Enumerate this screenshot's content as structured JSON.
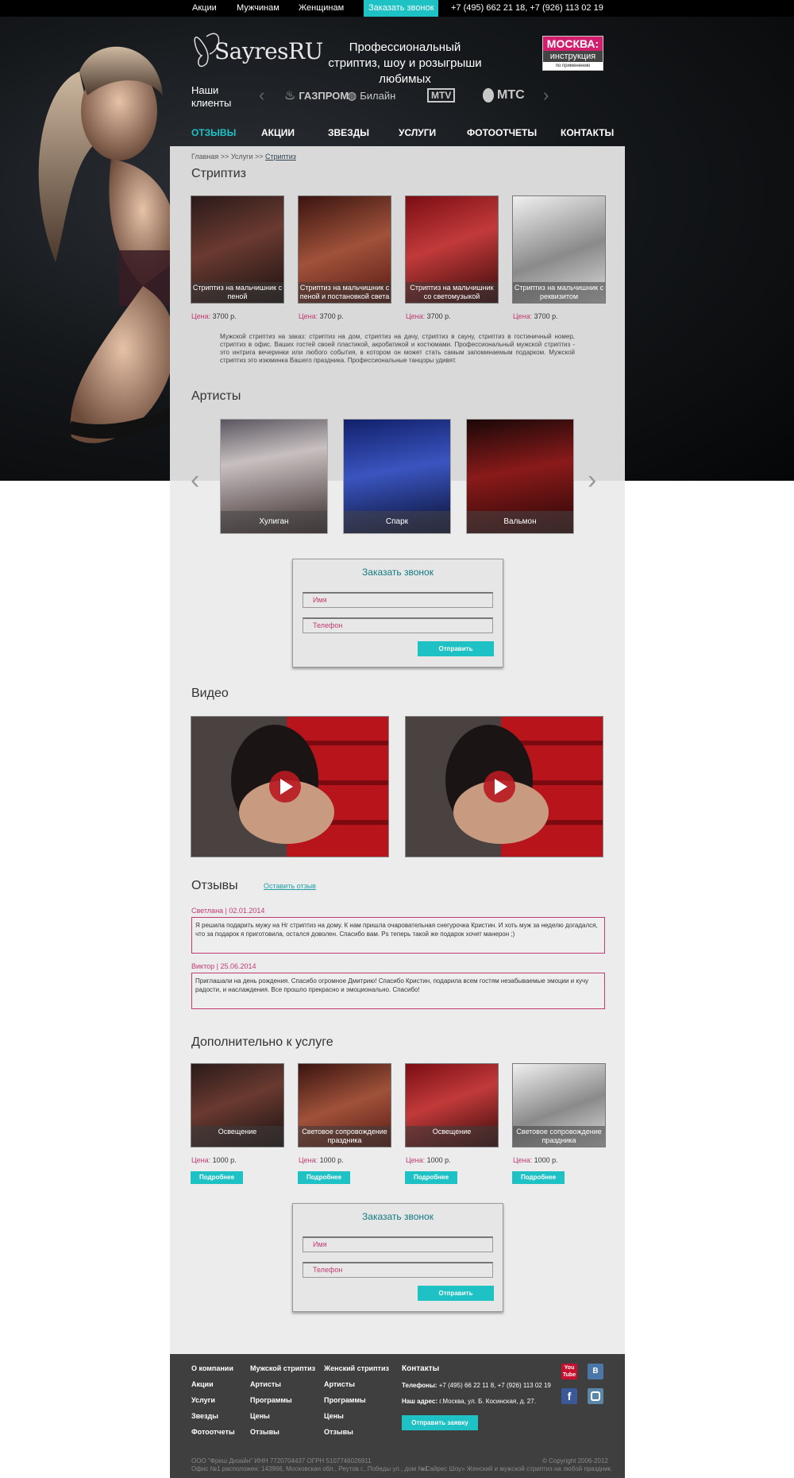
{
  "topbar": {
    "links": [
      "Акции",
      "Мужчинам",
      "Женщинам"
    ],
    "call_button": "Заказать звонок",
    "phones": "+7 (495) 662 21 18, +7 (926) 113 02 19"
  },
  "header": {
    "logo_text": "SayresRU",
    "tagline": "Профессиональный стриптиз, шоу и розыгрыши любимых",
    "moscow_badge": {
      "line1": "МОСКВА:",
      "line2": "инструкция",
      "line3": "по применению"
    },
    "clients_label": "Наши клиенты",
    "clients": [
      "ГАЗПРОМ",
      "Билайн",
      "MTV",
      "МТС"
    ]
  },
  "nav": [
    "ОТЗЫВЫ",
    "АКЦИИ",
    "ЗВЕЗДЫ",
    "УСЛУГИ",
    "ФОТООТЧЕТЫ",
    "КОНТАКТЫ"
  ],
  "breadcrumb": {
    "home": "Главная",
    "sep1": ">>",
    "services": "Услуги",
    "sep2": ">>",
    "current": "Стриптиз"
  },
  "striptease": {
    "title": "Стриптиз",
    "price_label": "Цена:",
    "items": [
      {
        "caption": "Стриптиз на мальчишник с пеной",
        "price": "3700 р."
      },
      {
        "caption": "Стриптиз на мальчишник с пеной и постановкой света",
        "price": "3700 р."
      },
      {
        "caption": "Стриптиз на мальчишник со светомузыкой",
        "price": "3700 р."
      },
      {
        "caption": "Стриптиз на мальчишник с реквизитом",
        "price": "3700 р."
      }
    ],
    "description": "Мужской стриптиз на заказ: стриптиз на дом, стриптиз на дачу, стриптиз в сауну, стриптиз в гостиничный номер, стриптиз в офис. Ваших гостей своей пластикой, акробатикой и костюмами. Профессиональный мужской стриптиз - это интрига вечеринки или любого события, в котором он может стать самым запоминаемым подарком. Мужской стриптиз это изюминка Вашего праздника. Профессиональные танцоры удивят."
  },
  "artists": {
    "title": "Артисты",
    "items": [
      "Хулиган",
      "Спарк",
      "Вальмон"
    ]
  },
  "callback_form": {
    "title": "Заказать звонок",
    "name_placeholder": "Имя",
    "phone_placeholder": "Телефон",
    "submit": "Отправить"
  },
  "video": {
    "title": "Видео"
  },
  "reviews": {
    "title": "Отзывы",
    "leave_link": "Оставить отзыв",
    "items": [
      {
        "author": "Светлана | 02.01.2014",
        "text": "Я решила подарить мужу на Нг стриптиз на дому. К нам пришла очаровательная снегурочка Кристин. И хоть муж за неделю догадался, что за подарок я приготовила, остался доволен. Спасибо вам. Ps теперь такой же подарок хочет манерон ;)"
      },
      {
        "author": "Виктор | 25.06.2014",
        "text": "Приглашали на день рождения. Спасибо огромное Дмитрию! Спасибо Кристин, подарила всем гостям незабываемые эмоции и кучу радости, и наслаждения. Все прошло прекрасно и эмоционально. Спасибо!"
      }
    ]
  },
  "extras": {
    "title": "Дополнительно к услуге",
    "price_label": "Цена:",
    "more_button": "Подробнее",
    "items": [
      {
        "caption": "Освещение",
        "price": "1000 р."
      },
      {
        "caption": "Световое сопровождение праздника",
        "price": "1000 р."
      },
      {
        "caption": "Освещение",
        "price": "1000 р."
      },
      {
        "caption": "Световое сопровождение праздника",
        "price": "1000 р."
      }
    ]
  },
  "footer": {
    "col1": [
      "О компании",
      "Акции",
      "Услуги",
      "Звезды",
      "Фотоотчеты"
    ],
    "col2": [
      "Мужской стриптиз",
      "Артисты",
      "Программы",
      "Цены",
      "Отзывы"
    ],
    "col3": [
      "Женский стриптиз",
      "Артисты",
      "Программы",
      "Цены",
      "Отзывы"
    ],
    "contacts_title": "Контакты",
    "phones_label": "Телефоны:",
    "phones": "+7 (495) 66 22 11 8, +7 (926) 113 02 19",
    "address_label": "Наш адрес:",
    "address": "г.Москва, ул. Б. Косинская, д. 27.",
    "request_button": "Отправить заявку",
    "legal_line1": "ООО \"Фреш Дизайн\" ИНН 7720704437 ОГРН 5107746026911",
    "legal_line2": "Офис №1 расположен: 143966, Московская обл., Реутов г., Победы ул., дом №1",
    "copyright": "© Copyright 2006-2012",
    "slogan": "«Сайрес Шоу» Женский и мужской стриптиз на любой праздник."
  },
  "colors": {
    "accent": "#1ec2c4",
    "pink": "#c13b73",
    "dark": "#050607",
    "footer": "#3f3f3f"
  }
}
